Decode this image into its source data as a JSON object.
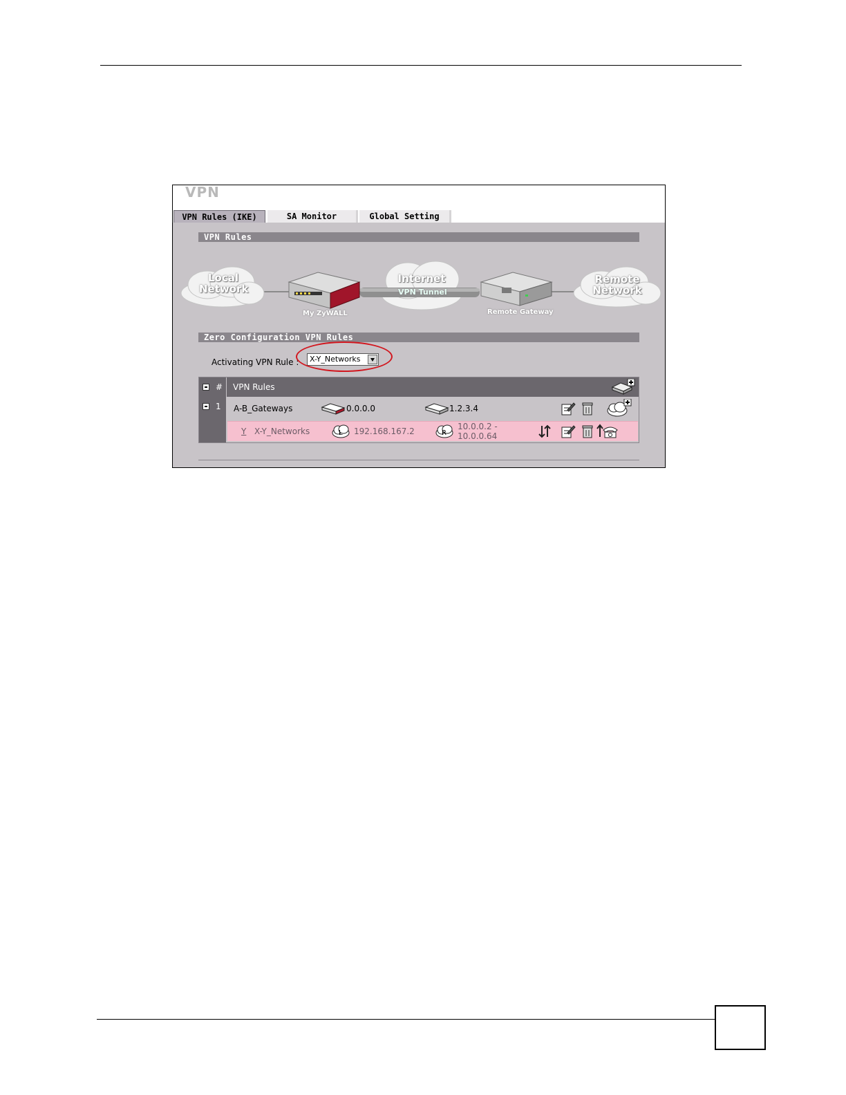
{
  "screen": {
    "title": "VPN",
    "tabs": [
      {
        "label": "VPN Rules (IKE)",
        "active": true
      },
      {
        "label": "SA Monitor",
        "active": false
      },
      {
        "label": "Global Setting",
        "active": false
      }
    ],
    "sections": {
      "vpn_rules": "VPN Rules",
      "zero_config": "Zero Configuration VPN Rules"
    },
    "diagram": {
      "local_line1": "Local",
      "local_line2": "Network",
      "my_device": "My ZyWALL",
      "internet": "Internet",
      "tunnel": "VPN Tunnel",
      "remote_gateway": "Remote Gateway",
      "remote_line1": "Remote",
      "remote_line2": "Network"
    },
    "activating": {
      "label": "Activating VPN Rule :",
      "selected": "X-Y_Networks"
    },
    "table": {
      "col_hash": "#",
      "col_rules": "VPN Rules",
      "gateway_row": {
        "index": "1",
        "name": "A-B_Gateways",
        "my_ip": "0.0.0.0",
        "remote_ip": "1.2.3.4"
      },
      "network_row": {
        "flag": "Y",
        "name": "X-Y_Networks",
        "local": "192.168.167.2",
        "remote_line1": "10.0.0.2 -",
        "remote_line2": "10.0.0.64"
      }
    },
    "icons": [
      "add-gateway-icon",
      "collapse-icon",
      "zywall-device-icon",
      "remote-gateway-icon",
      "edit-icon",
      "delete-icon",
      "add-network-policy-icon",
      "local-network-icon",
      "remote-network-icon",
      "connect-icon",
      "dial-icon"
    ],
    "colors": {
      "highlight_circle": "#d2161e",
      "active_row": "#f6c0cf",
      "panel": "#c8c4c8",
      "header": "#6b676d"
    }
  }
}
